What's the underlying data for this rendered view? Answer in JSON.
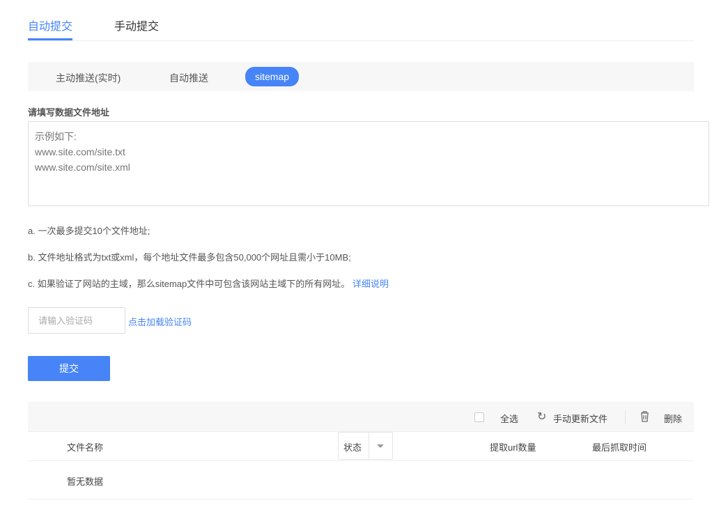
{
  "tabs": [
    "自动提交",
    "手动提交"
  ],
  "sub_tabs": [
    "主动推送(实时)",
    "自动推送",
    "sitemap"
  ],
  "form": {
    "label": "请填写数据文件地址",
    "placeholder": "示例如下:\nwww.site.com/site.txt\nwww.site.com/site.xml"
  },
  "notes": {
    "a": "a. 一次最多提交10个文件地址;",
    "b": "b. 文件地址格式为txt或xml，每个地址文件最多包含50,000个网址且需小于10MB;",
    "c": "c. 如果验证了网站的主域，那么sitemap文件中可包含该网站主域下的所有网址。",
    "c_link": "详细说明"
  },
  "captcha": {
    "placeholder": "请输入验证码",
    "link": "点击加载验证码"
  },
  "submit": "提交",
  "toolbar": {
    "select_all": "全选",
    "refresh": "手动更新文件",
    "delete": "删除"
  },
  "table": {
    "headers": [
      "文件名称",
      "状态",
      "提取url数量",
      "最后抓取时间"
    ],
    "empty": "暂无数据"
  }
}
